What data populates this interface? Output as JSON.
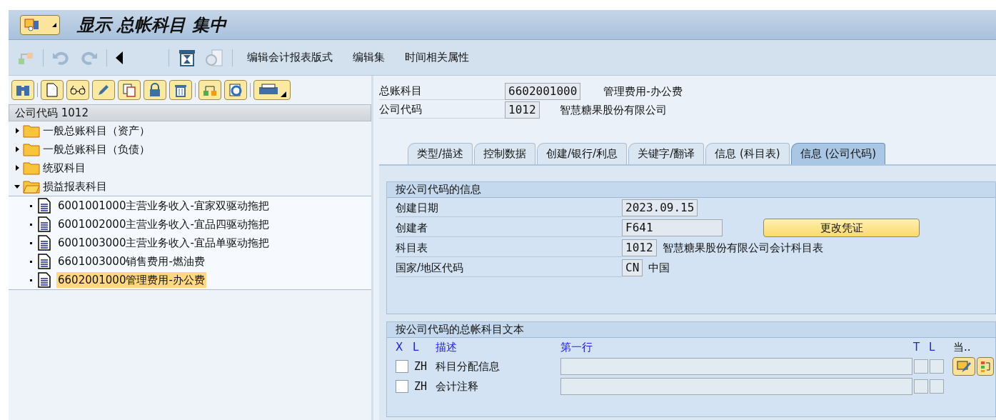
{
  "window": {
    "title": "显示 总帐科目 集中"
  },
  "toolbar": {
    "buttons": [
      "编辑会计报表版式",
      "编辑集",
      "时间相关属性"
    ]
  },
  "tree": {
    "header": "公司代码 1012",
    "items": [
      {
        "label": "一般总账科目（资产）",
        "expanded": false
      },
      {
        "label": "一般总账科目（负债）",
        "expanded": false
      },
      {
        "label": "统驭科目",
        "expanded": false
      },
      {
        "label": "损益报表科目",
        "expanded": true,
        "children": [
          {
            "label": "6001001000主营业务收入-宜家双驱动拖把",
            "selected": false
          },
          {
            "label": "6001002000主营业务收入-宜品四驱动拖把",
            "selected": false
          },
          {
            "label": "6001003000主营业务收入-宜品单驱动拖把",
            "selected": false
          },
          {
            "label": "6601003000销售费用-燃油费",
            "selected": false
          },
          {
            "label": "6602001000管理费用-办公费",
            "selected": true
          }
        ]
      }
    ]
  },
  "header_fields": [
    {
      "label": "总账科目",
      "value": "6602001000",
      "description": "管理费用-办公费"
    },
    {
      "label": "公司代码",
      "value": "1012",
      "description": "智慧糖果股份有限公司"
    }
  ],
  "tabs": [
    {
      "label": "类型/描述",
      "selected": false
    },
    {
      "label": "控制数据",
      "selected": false
    },
    {
      "label": "创建/银行/利息",
      "selected": false
    },
    {
      "label": "关键字/翻译",
      "selected": false
    },
    {
      "label": "信息 (科目表)",
      "selected": false
    },
    {
      "label": "信息 (公司代码)",
      "selected": true
    }
  ],
  "info_group": {
    "title": "按公司代码的信息",
    "fields": [
      {
        "label": "创建日期",
        "value": "2023.09.15"
      },
      {
        "label": "创建者",
        "value": "F641"
      },
      {
        "label": "科目表",
        "value": "1012",
        "description": "智慧糖果股份有限公司会计科目表"
      },
      {
        "label": "国家/地区代码",
        "value": "CN",
        "description": "中国"
      }
    ],
    "button": "更改凭证"
  },
  "text_group": {
    "title": "按公司代码的总帐科目文本",
    "columns": [
      "X",
      "L",
      "描述",
      "第一行",
      "T",
      "L",
      "当.."
    ],
    "rows": [
      {
        "checked": false,
        "language": "ZH",
        "description": "科目分配信息"
      },
      {
        "checked": false,
        "language": "ZH",
        "description": "会计注释"
      }
    ]
  }
}
